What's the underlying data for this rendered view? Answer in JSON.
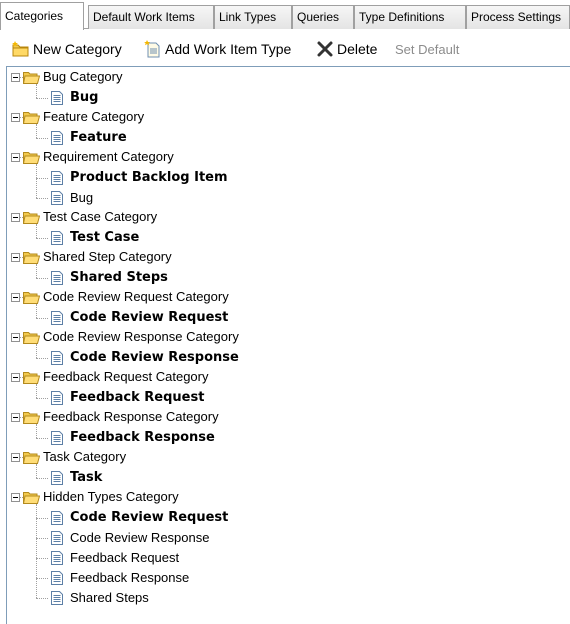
{
  "tabs": [
    {
      "label": "Categories",
      "active": true
    },
    {
      "label": "Default Work Items"
    },
    {
      "label": "Link Types"
    },
    {
      "label": "Queries"
    },
    {
      "label": "Type Definitions"
    },
    {
      "label": "Process Settings"
    }
  ],
  "toolbar": {
    "new_category": "New Category",
    "add_work_item_type": "Add Work Item Type",
    "delete": "Delete",
    "set_default": "Set Default"
  },
  "tree": [
    {
      "category": "Bug Category",
      "items": [
        {
          "label": "Bug",
          "default": true
        }
      ]
    },
    {
      "category": "Feature Category",
      "items": [
        {
          "label": "Feature",
          "default": true
        }
      ]
    },
    {
      "category": "Requirement Category",
      "items": [
        {
          "label": "Product Backlog Item",
          "default": true
        },
        {
          "label": "Bug",
          "default": false
        }
      ]
    },
    {
      "category": "Test Case Category",
      "items": [
        {
          "label": "Test Case",
          "default": true
        }
      ]
    },
    {
      "category": "Shared Step Category",
      "items": [
        {
          "label": "Shared Steps",
          "default": true
        }
      ]
    },
    {
      "category": "Code Review Request Category",
      "items": [
        {
          "label": "Code Review Request",
          "default": true
        }
      ]
    },
    {
      "category": "Code Review Response Category",
      "items": [
        {
          "label": "Code Review Response",
          "default": true
        }
      ]
    },
    {
      "category": "Feedback Request Category",
      "items": [
        {
          "label": "Feedback Request",
          "default": true
        }
      ]
    },
    {
      "category": "Feedback Response Category",
      "items": [
        {
          "label": "Feedback Response",
          "default": true
        }
      ]
    },
    {
      "category": "Task Category",
      "items": [
        {
          "label": "Task",
          "default": true
        }
      ]
    },
    {
      "category": "Hidden Types Category",
      "items": [
        {
          "label": "Code Review Request",
          "default": true
        },
        {
          "label": "Code Review Response",
          "default": false
        },
        {
          "label": "Feedback Request",
          "default": false
        },
        {
          "label": "Feedback Response",
          "default": false
        },
        {
          "label": "Shared Steps",
          "default": false
        }
      ]
    }
  ],
  "colors": {
    "tree_border": "#7f9db9",
    "folder": "#f2c94c",
    "delete_x": "#333333",
    "disabled_text": "#8c8c8c"
  }
}
